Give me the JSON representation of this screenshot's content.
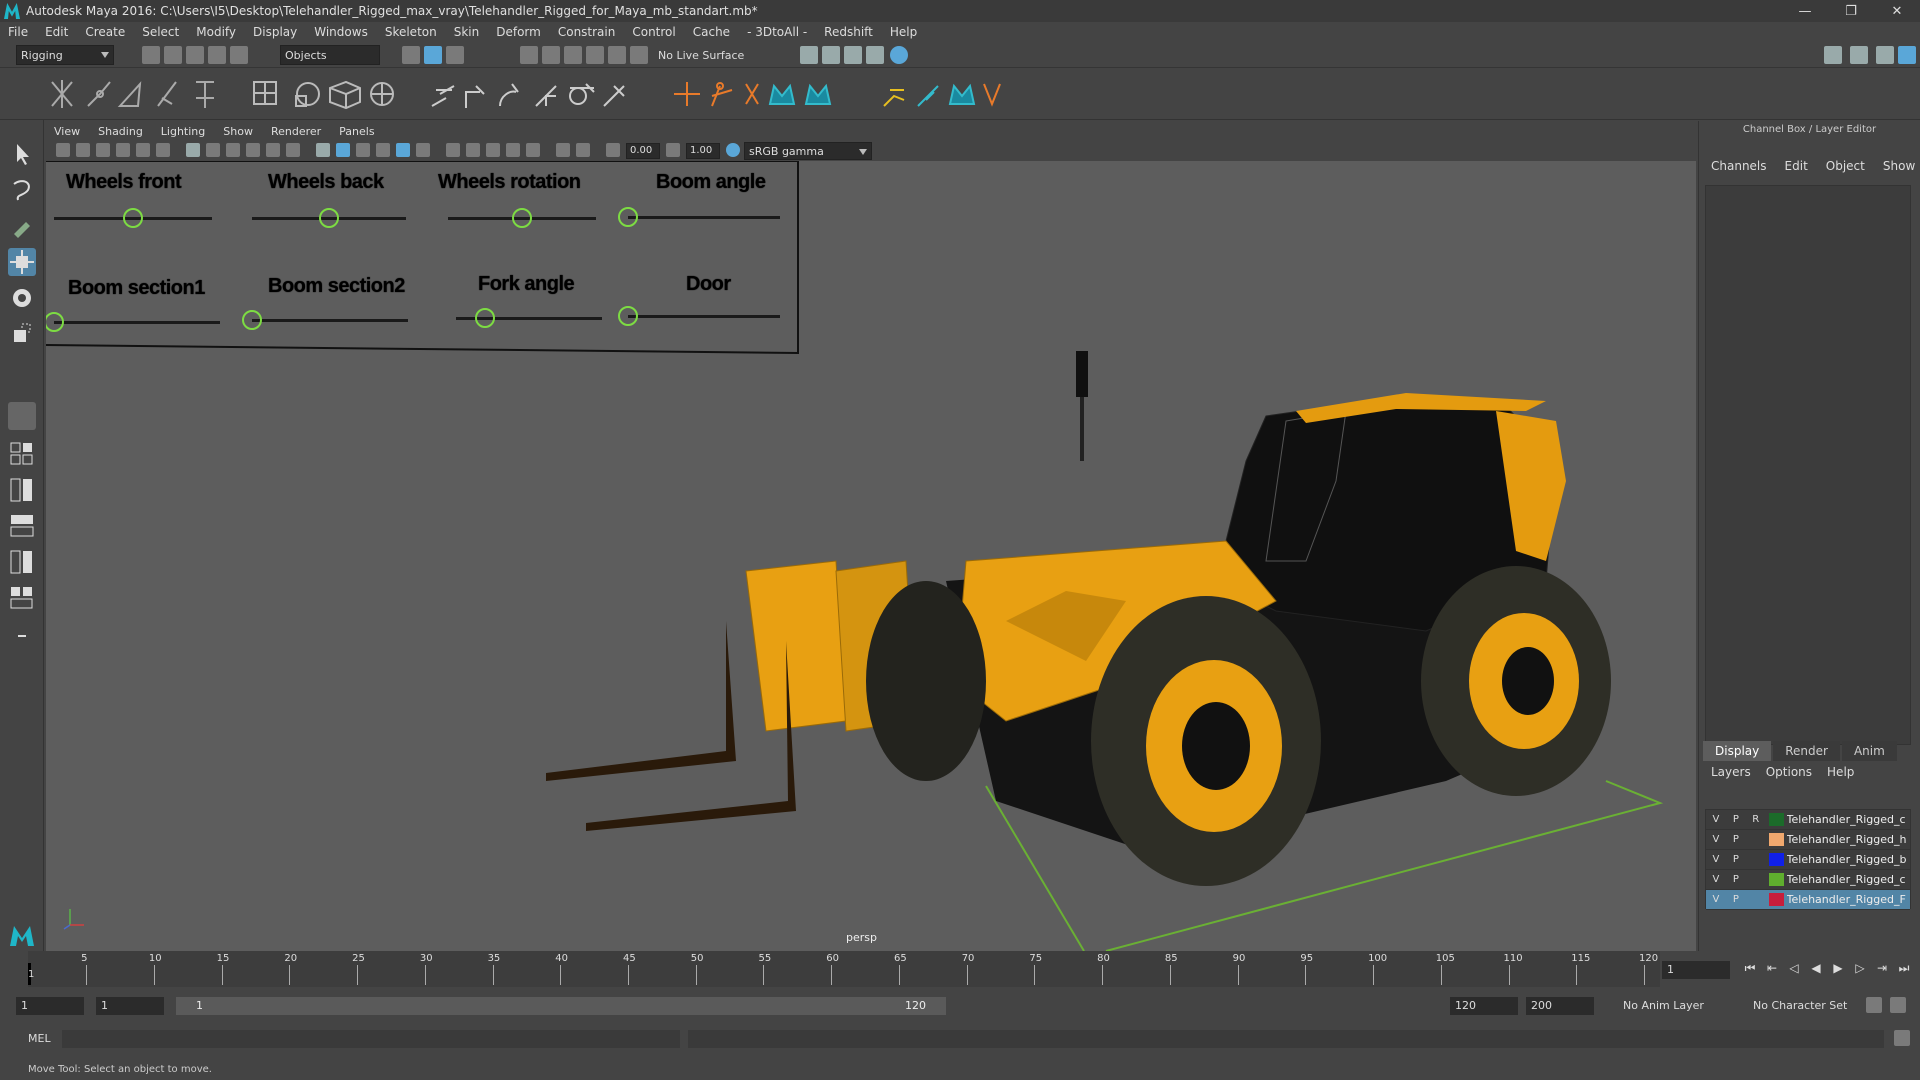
{
  "window": {
    "title": "Autodesk Maya 2016: C:\\Users\\I5\\Desktop\\Telehandler_Rigged_max_vray\\Telehandler_Rigged_for_Maya_mb_standart.mb*",
    "min": "—",
    "max": "❐",
    "close": "✕"
  },
  "menubar": [
    "File",
    "Edit",
    "Create",
    "Select",
    "Modify",
    "Display",
    "Windows",
    "Skeleton",
    "Skin",
    "Deform",
    "Constrain",
    "Control",
    "Cache",
    "- 3DtoAll -",
    "Redshift",
    "Help"
  ],
  "status_line": {
    "menuset": "Rigging",
    "select_mode": "Objects",
    "live_surface": "No Live Surface"
  },
  "panel": {
    "menus": [
      "View",
      "Shading",
      "Lighting",
      "Show",
      "Renderer",
      "Panels"
    ],
    "exposure": "0.00",
    "gamma": "1.00",
    "color_space": "sRGB gamma",
    "camera": "persp"
  },
  "rig_sliders": [
    {
      "label": "Wheels front",
      "value": 0.5
    },
    {
      "label": "Wheels back",
      "value": 0.5
    },
    {
      "label": "Wheels rotation",
      "value": 0.5
    },
    {
      "label": "Boom angle",
      "value": 0.0
    },
    {
      "label": "Boom section1",
      "value": 0.0
    },
    {
      "label": "Boom section2",
      "value": 0.0
    },
    {
      "label": "Fork angle",
      "value": 0.2
    },
    {
      "label": "Door",
      "value": 0.0
    }
  ],
  "channel_box": {
    "title": "Channel Box / Layer Editor",
    "menus": [
      "Channels",
      "Edit",
      "Object",
      "Show"
    ],
    "tabs": [
      "Display",
      "Render",
      "Anim"
    ],
    "layer_menus": [
      "Layers",
      "Options",
      "Help"
    ],
    "layers": [
      {
        "v": "V",
        "p": "P",
        "r": "R",
        "name": "Telehandler_Rigged_c",
        "color": "#1b6b2a"
      },
      {
        "v": "V",
        "p": "P",
        "r": "",
        "name": "Telehandler_Rigged_h",
        "color": "#f0a86e"
      },
      {
        "v": "V",
        "p": "P",
        "r": "",
        "name": "Telehandler_Rigged_b",
        "color": "#1020e8"
      },
      {
        "v": "V",
        "p": "P",
        "r": "",
        "name": "Telehandler_Rigged_c",
        "color": "#5fae2e"
      },
      {
        "v": "V",
        "p": "P",
        "r": "",
        "name": "Telehandler_Rigged_F",
        "color": "#c81e3c"
      }
    ]
  },
  "time_slider": {
    "ticks": [
      "5",
      "10",
      "15",
      "20",
      "25",
      "30",
      "35",
      "40",
      "45",
      "50",
      "55",
      "60",
      "65",
      "70",
      "75",
      "80",
      "85",
      "90",
      "95",
      "100",
      "105",
      "110",
      "115",
      "120"
    ],
    "current_frame_marker": "1",
    "current_frame": "1"
  },
  "range_slider": {
    "start": "1",
    "playback_start": "1",
    "range_start_label": "1",
    "range_end_label": "120",
    "playback_end": "120",
    "end": "200",
    "anim_layer": "No Anim Layer",
    "char_set": "No Character Set"
  },
  "command_line": {
    "mode": "MEL"
  },
  "help_line": "Move Tool: Select an object to move."
}
